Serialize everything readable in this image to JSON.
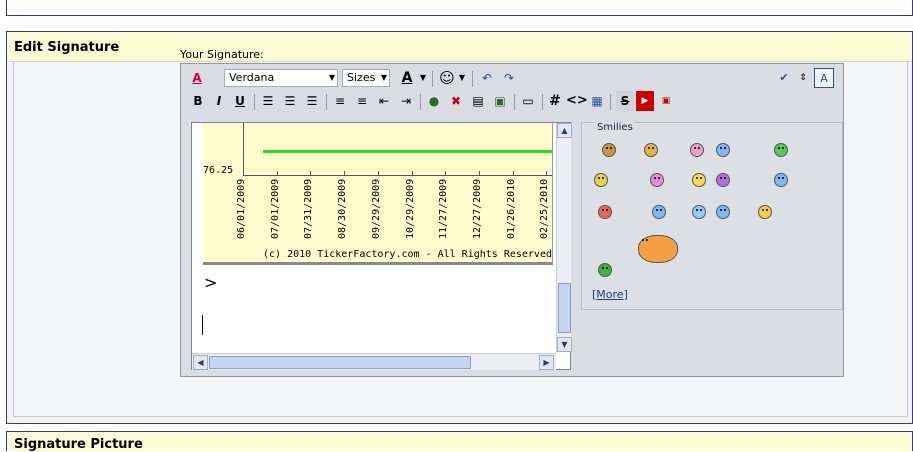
{
  "panel": {
    "title": "Edit Signature"
  },
  "signature_label": "Your Signature:",
  "toolbar": {
    "font_name": "Verdana",
    "font_size": "Sizes",
    "font_color_glyph": "A",
    "bold": "B",
    "italic": "I",
    "underline": "U",
    "hash": "#",
    "code": "<>"
  },
  "ticker": {
    "y_label": "76.25",
    "dates": [
      "06/01/2009",
      "07/01/2009",
      "07/31/2009",
      "08/30/2009",
      "09/29/2009",
      "10/29/2009",
      "11/27/2009",
      "12/27/2009",
      "01/26/2010",
      "02/25/2010"
    ],
    "copyright": "(c) 2010 TickerFactory.com - All Rights Reserved",
    "line_color": "#22dd22"
  },
  "content_text": ">",
  "smilies": {
    "title": "Smilies",
    "more_label": "More",
    "icons": [
      "cool-smiley",
      "eyes-smiley",
      "tongue-smiley",
      "blue-smiley",
      "grin-smiley",
      "dizzy-smiley",
      "pink-smiley",
      "laugh-smiley",
      "purple-smiley",
      "confused-smiley",
      "angry-smiley",
      "roll-eyes-smiley",
      "sunglasses-smiley",
      "shocked-smiley",
      "wave-smiley",
      "balloons-smiley",
      "small-green-smiley"
    ]
  },
  "next_panel": {
    "title": "Signature Picture"
  }
}
